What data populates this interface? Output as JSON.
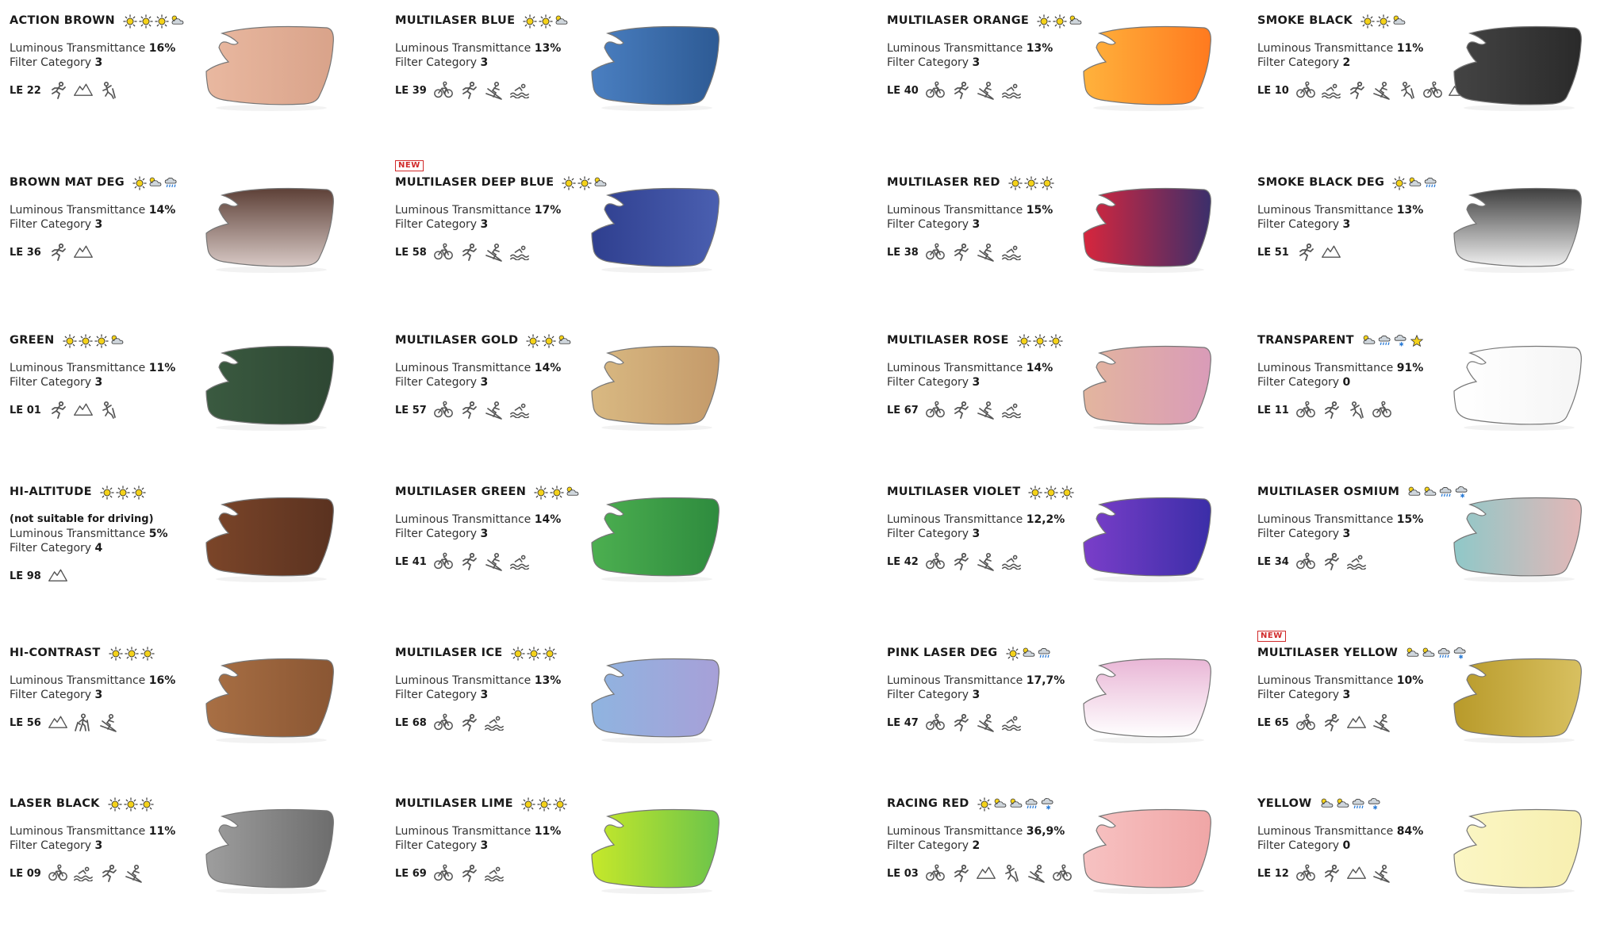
{
  "lt_label": "Luminous Transmittance",
  "fc_label": "Filter Category",
  "new_label": "NEW",
  "lenses": [
    {
      "name": "ACTION BROWN",
      "lt": "16%",
      "fc": "3",
      "code": "LE 22",
      "weather": [
        "sun",
        "sun",
        "sun",
        "cloud"
      ],
      "sports": [
        "run",
        "mountain",
        "climb"
      ],
      "colors": [
        "#e9b8a0",
        "#d9a38a"
      ],
      "col": 0,
      "row": 0
    },
    {
      "name": "BROWN MAT DEG",
      "lt": "14%",
      "fc": "3",
      "code": "LE 36",
      "weather": [
        "sun",
        "cloud",
        "rain"
      ],
      "sports": [
        "run",
        "mountain"
      ],
      "colors": [
        "#5d4037",
        "#d7c8c4"
      ],
      "col": 0,
      "row": 1
    },
    {
      "name": "GREEN",
      "lt": "11%",
      "fc": "3",
      "code": "LE 01",
      "weather": [
        "sun",
        "sun",
        "sun",
        "cloud"
      ],
      "sports": [
        "run",
        "mountain",
        "climb"
      ],
      "colors": [
        "#3a5a40",
        "#2e4733"
      ],
      "col": 0,
      "row": 2
    },
    {
      "name": "HI-ALTITUDE",
      "note": "(not suitable for driving)",
      "lt": "5%",
      "fc": "4",
      "code": "LE 98",
      "weather": [
        "sun",
        "sun",
        "sun"
      ],
      "sports": [
        "mountain"
      ],
      "colors": [
        "#7b4529",
        "#5a3220"
      ],
      "col": 0,
      "row": 3
    },
    {
      "name": "HI-CONTRAST",
      "lt": "16%",
      "fc": "3",
      "code": "LE 56",
      "weather": [
        "sun",
        "sun",
        "sun"
      ],
      "sports": [
        "mountain",
        "hike",
        "ski"
      ],
      "colors": [
        "#a86f44",
        "#8a5633"
      ],
      "col": 0,
      "row": 4
    },
    {
      "name": "LASER BLACK",
      "lt": "11%",
      "fc": "3",
      "code": "LE 09",
      "weather": [
        "sun",
        "sun",
        "sun"
      ],
      "sports": [
        "bike",
        "swim",
        "run",
        "ski"
      ],
      "colors": [
        "#9e9e9e",
        "#6d6d6d"
      ],
      "col": 0,
      "row": 5
    },
    {
      "name": "MULTILASER BLUE",
      "lt": "13%",
      "fc": "3",
      "code": "LE 39",
      "weather": [
        "sun",
        "sun",
        "cloud"
      ],
      "sports": [
        "bike",
        "run",
        "ski",
        "swim"
      ],
      "colors": [
        "#4a7fc1",
        "#2d5a94"
      ],
      "col": 1,
      "row": 0
    },
    {
      "name": "MULTILASER DEEP BLUE",
      "new": true,
      "lt": "17%",
      "fc": "3",
      "code": "LE 58",
      "weather": [
        "sun",
        "sun",
        "cloud"
      ],
      "sports": [
        "bike",
        "run",
        "ski",
        "swim"
      ],
      "colors": [
        "#2f3f8f",
        "#4a5fb0"
      ],
      "col": 1,
      "row": 1
    },
    {
      "name": "MULTILASER GOLD",
      "lt": "14%",
      "fc": "3",
      "code": "LE 57",
      "weather": [
        "sun",
        "sun",
        "cloud"
      ],
      "sports": [
        "bike",
        "run",
        "ski",
        "swim"
      ],
      "colors": [
        "#d9b982",
        "#c49a6a"
      ],
      "col": 1,
      "row": 2
    },
    {
      "name": "MULTILASER GREEN",
      "lt": "14%",
      "fc": "3",
      "code": "LE 41",
      "weather": [
        "sun",
        "sun",
        "cloud"
      ],
      "sports": [
        "bike",
        "run",
        "ski",
        "swim"
      ],
      "colors": [
        "#4caf50",
        "#2e8b3e"
      ],
      "col": 1,
      "row": 3
    },
    {
      "name": "MULTILASER ICE",
      "lt": "13%",
      "fc": "3",
      "code": "LE 68",
      "weather": [
        "sun",
        "sun",
        "sun"
      ],
      "sports": [
        "bike",
        "run",
        "swim"
      ],
      "colors": [
        "#8fb4e0",
        "#a7a0d8"
      ],
      "col": 1,
      "row": 4
    },
    {
      "name": "MULTILASER LIME",
      "lt": "11%",
      "fc": "3",
      "code": "LE 69",
      "weather": [
        "sun",
        "sun",
        "sun"
      ],
      "sports": [
        "bike",
        "run",
        "swim"
      ],
      "colors": [
        "#c6e82a",
        "#6cc44a"
      ],
      "col": 1,
      "row": 5
    },
    {
      "name": "MULTILASER ORANGE",
      "lt": "13%",
      "fc": "3",
      "code": "LE 40",
      "weather": [
        "sun",
        "sun",
        "cloud"
      ],
      "sports": [
        "bike",
        "run",
        "ski",
        "swim"
      ],
      "colors": [
        "#ffb23c",
        "#ff7a1f"
      ],
      "col": 2,
      "row": 0
    },
    {
      "name": "MULTILASER RED",
      "lt": "15%",
      "fc": "3",
      "code": "LE 38",
      "weather": [
        "sun",
        "sun",
        "sun"
      ],
      "sports": [
        "bike",
        "run",
        "ski",
        "swim"
      ],
      "colors": [
        "#d7263d",
        "#3b2f6b"
      ],
      "col": 2,
      "row": 1
    },
    {
      "name": "MULTILASER ROSE",
      "lt": "14%",
      "fc": "3",
      "code": "LE 67",
      "weather": [
        "sun",
        "sun",
        "sun"
      ],
      "sports": [
        "bike",
        "run",
        "ski",
        "swim"
      ],
      "colors": [
        "#e3b59e",
        "#d99bb8"
      ],
      "col": 2,
      "row": 2
    },
    {
      "name": "MULTILASER VIOLET",
      "lt": "12,2%",
      "fc": "3",
      "code": "LE 42",
      "weather": [
        "sun",
        "sun",
        "sun"
      ],
      "sports": [
        "bike",
        "run",
        "ski",
        "swim"
      ],
      "colors": [
        "#7a3ec9",
        "#3b2ea8"
      ],
      "col": 2,
      "row": 3
    },
    {
      "name": "PINK LASER DEG",
      "lt": "17,7%",
      "fc": "3",
      "code": "LE 47",
      "weather": [
        "sun",
        "cloud",
        "rain"
      ],
      "sports": [
        "bike",
        "run",
        "ski",
        "swim"
      ],
      "colors": [
        "#e9b6d6",
        "#ffffff"
      ],
      "col": 2,
      "row": 4
    },
    {
      "name": "RACING RED",
      "lt": "36,9%",
      "fc": "2",
      "code": "LE 03",
      "weather": [
        "sun",
        "cloud",
        "cloud",
        "rain",
        "snow"
      ],
      "sports": [
        "bike",
        "run",
        "mountain",
        "climb",
        "ski",
        "bike"
      ],
      "colors": [
        "#f7c2c2",
        "#f0a6a6"
      ],
      "col": 2,
      "row": 5
    },
    {
      "name": "SMOKE BLACK",
      "lt": "11%",
      "fc": "2",
      "code": "LE 10",
      "weather": [
        "sun",
        "sun",
        "cloud"
      ],
      "sports": [
        "bike",
        "swim",
        "run",
        "ski",
        "climb",
        "bike",
        "mountain"
      ],
      "colors": [
        "#444444",
        "#2a2a2a"
      ],
      "col": 3,
      "row": 0
    },
    {
      "name": "SMOKE BLACK DEG",
      "lt": "13%",
      "fc": "3",
      "code": "LE 51",
      "weather": [
        "sun",
        "cloud",
        "rain"
      ],
      "sports": [
        "run",
        "mountain"
      ],
      "colors": [
        "#3f3f3f",
        "#f0f0f0"
      ],
      "col": 3,
      "row": 1
    },
    {
      "name": "TRANSPARENT",
      "lt": "91%",
      "fc": "0",
      "code": "LE 11",
      "weather": [
        "cloud",
        "rain",
        "snow",
        "star"
      ],
      "sports": [
        "bike",
        "run",
        "climb",
        "bike"
      ],
      "colors": [
        "#ffffff",
        "#f5f5f5"
      ],
      "col": 3,
      "row": 2
    },
    {
      "name": "MULTILASER OSMIUM",
      "lt": "15%",
      "fc": "3",
      "code": "LE 34",
      "weather": [
        "cloud",
        "cloud",
        "rain",
        "snow"
      ],
      "sports": [
        "bike",
        "run",
        "swim"
      ],
      "colors": [
        "#8fc8c8",
        "#e3b7b7"
      ],
      "col": 3,
      "row": 3
    },
    {
      "name": "MULTILASER YELLOW",
      "new": true,
      "lt": "10%",
      "fc": "3",
      "code": "LE 65",
      "weather": [
        "cloud",
        "cloud",
        "rain",
        "snow"
      ],
      "sports": [
        "bike",
        "run",
        "mountain",
        "ski"
      ],
      "colors": [
        "#b89a2a",
        "#d8c060"
      ],
      "col": 3,
      "row": 4
    },
    {
      "name": "YELLOW",
      "lt": "84%",
      "fc": "0",
      "code": "LE 12",
      "weather": [
        "cloud",
        "cloud",
        "rain",
        "snow"
      ],
      "sports": [
        "bike",
        "run",
        "mountain",
        "ski"
      ],
      "colors": [
        "#fbf6c4",
        "#f7efb0"
      ],
      "col": 3,
      "row": 5
    }
  ]
}
